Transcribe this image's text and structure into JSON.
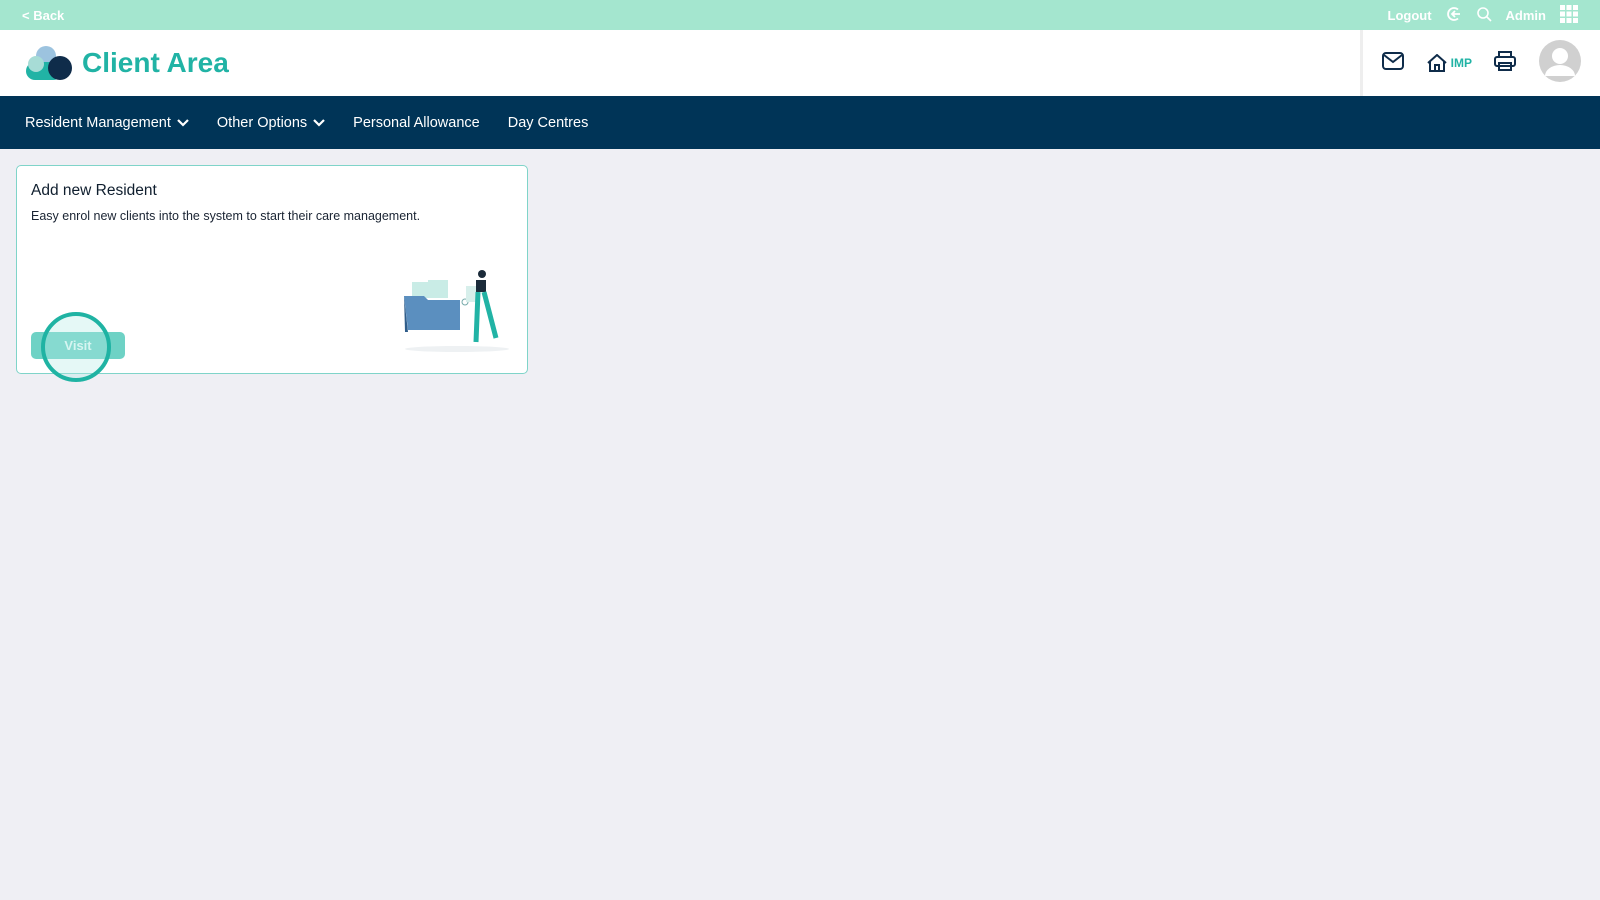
{
  "topbar": {
    "back": "< Back",
    "logout": "Logout",
    "admin": "Admin"
  },
  "header": {
    "title": "Client Area",
    "home_label": "IMP"
  },
  "nav": {
    "items": [
      {
        "label": "Resident Management",
        "dropdown": true
      },
      {
        "label": "Other Options",
        "dropdown": true
      },
      {
        "label": "Personal Allowance"
      },
      {
        "label": "Day Centres"
      }
    ]
  },
  "card": {
    "title": "Add new Resident",
    "description": "Easy enrol new clients into the system to start their care management.",
    "button": "Visit"
  },
  "colors": {
    "topbar": "#a4e6cf",
    "nav": "#003457",
    "accent": "#21b3a5"
  }
}
